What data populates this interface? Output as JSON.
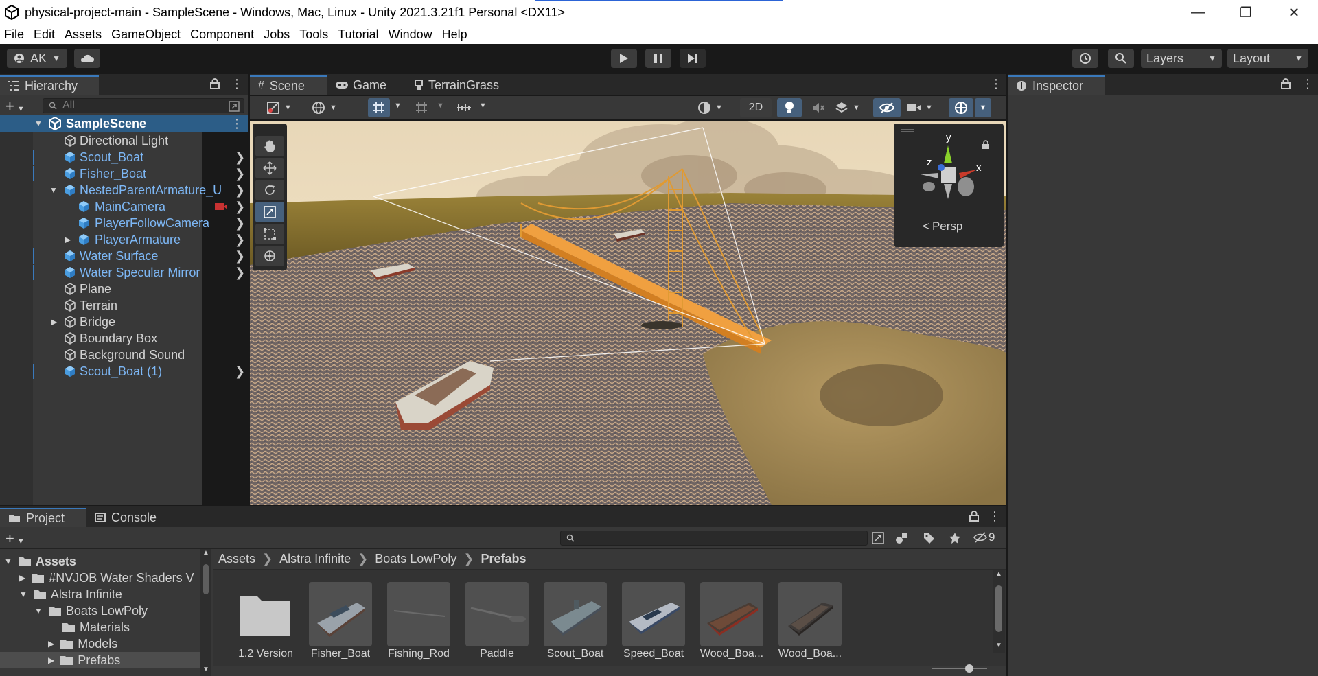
{
  "window": {
    "title": "physical-project-main - SampleScene - Windows, Mac, Linux - Unity 2021.3.21f1 Personal <DX11>",
    "controls": [
      "minimize-icon",
      "restore-icon",
      "close-icon"
    ]
  },
  "menu": [
    "File",
    "Edit",
    "Assets",
    "GameObject",
    "Component",
    "Jobs",
    "Tools",
    "Tutorial",
    "Window",
    "Help"
  ],
  "toolbar": {
    "account": "AK",
    "layers_label": "Layers",
    "layout_label": "Layout"
  },
  "hierarchy": {
    "tab": "Hierarchy",
    "search_placeholder": "All",
    "scene": "SampleScene",
    "items": [
      {
        "label": "Directional Light",
        "prefab": false
      },
      {
        "label": "Scout_Boat",
        "prefab": true
      },
      {
        "label": "Fisher_Boat",
        "prefab": true
      },
      {
        "label": "NestedParentArmature_U",
        "prefab": true
      },
      {
        "label": "MainCamera",
        "prefab": true
      },
      {
        "label": "PlayerFollowCamera",
        "prefab": true
      },
      {
        "label": "PlayerArmature",
        "prefab": true
      },
      {
        "label": "Water Surface",
        "prefab": true
      },
      {
        "label": "Water Specular Mirror",
        "prefab": true
      },
      {
        "label": "Plane",
        "prefab": false
      },
      {
        "label": "Terrain",
        "prefab": false
      },
      {
        "label": "Bridge",
        "prefab": false
      },
      {
        "label": "Boundary Box",
        "prefab": false
      },
      {
        "label": "Background Sound",
        "prefab": false
      },
      {
        "label": "Scout_Boat (1)",
        "prefab": true
      }
    ]
  },
  "scene": {
    "tabs": [
      "Scene",
      "Game",
      "TerrainGrass"
    ],
    "toggle_2d": "2D",
    "gizmo": {
      "y": "y",
      "x": "x",
      "z": "z",
      "persp": "Persp"
    }
  },
  "inspector": {
    "tab": "Inspector"
  },
  "project": {
    "tabs": [
      "Project",
      "Console"
    ],
    "hidden_count": "9",
    "tree": [
      {
        "label": "Assets",
        "bold": true
      },
      {
        "label": "#NVJOB Water Shaders V",
        "bold": false
      },
      {
        "label": "Alstra Infinite",
        "bold": false
      },
      {
        "label": "Boats LowPoly",
        "bold": false
      },
      {
        "label": "Materials",
        "bold": false
      },
      {
        "label": "Models",
        "bold": false
      },
      {
        "label": "Prefabs",
        "bold": false
      }
    ],
    "breadcrumb": [
      "Assets",
      "Alstra Infinite",
      "Boats LowPoly",
      "Prefabs"
    ],
    "assets": [
      "1.2 Version",
      "Fisher_Boat",
      "Fishing_Rod",
      "Paddle",
      "Scout_Boat",
      "Speed_Boat",
      "Wood_Boa...",
      "Wood_Boa..."
    ]
  }
}
